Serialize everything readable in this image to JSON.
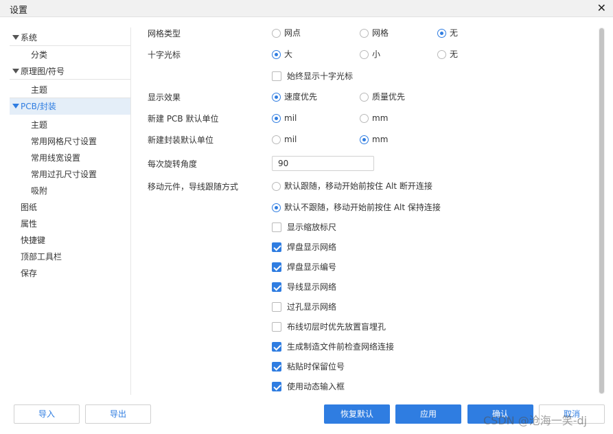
{
  "window": {
    "title": "设置",
    "close_glyph": "✕"
  },
  "sidebar": {
    "items": [
      {
        "label": "系统",
        "expanded": true
      },
      {
        "label": "分类"
      },
      {
        "label": "原理图/符号",
        "expanded": true
      },
      {
        "label": "主题"
      },
      {
        "label": "PCB/封装",
        "expanded": true,
        "selected": true
      },
      {
        "label": "主题"
      },
      {
        "label": "常用网格尺寸设置"
      },
      {
        "label": "常用线宽设置"
      },
      {
        "label": "常用过孔尺寸设置"
      },
      {
        "label": "吸附"
      },
      {
        "label": "图纸"
      },
      {
        "label": "属性"
      },
      {
        "label": "快捷键"
      },
      {
        "label": "顶部工具栏"
      },
      {
        "label": "保存"
      }
    ]
  },
  "settings": {
    "grid_type": {
      "label": "网格类型",
      "options": [
        "网点",
        "网格",
        "无"
      ],
      "selected": "无"
    },
    "crosshair": {
      "label": "十字光标",
      "options": [
        "大",
        "小",
        "无"
      ],
      "selected": "大",
      "always_show_label": "始终显示十字光标",
      "always_show": false
    },
    "display_effect": {
      "label": "显示效果",
      "options": [
        "速度优先",
        "质量优先"
      ],
      "selected": "速度优先"
    },
    "pcb_unit": {
      "label": "新建 PCB 默认单位",
      "options": [
        "mil",
        "mm"
      ],
      "selected": "mil"
    },
    "footprint_unit": {
      "label": "新建封装默认单位",
      "options": [
        "mil",
        "mm"
      ],
      "selected": "mm"
    },
    "rotation": {
      "label": "每次旋转角度",
      "value": "90"
    },
    "move_mode": {
      "label": "移动元件，导线跟随方式",
      "options": [
        "默认跟随，移动开始前按住 Alt 断开连接",
        "默认不跟随，移动开始前按住 Alt 保持连接"
      ],
      "selected": "默认不跟随，移动开始前按住 Alt 保持连接"
    },
    "checkboxes": [
      {
        "label": "显示缩放标尺",
        "checked": false
      },
      {
        "label": "焊盘显示网络",
        "checked": true
      },
      {
        "label": "焊盘显示编号",
        "checked": true
      },
      {
        "label": "导线显示网络",
        "checked": true
      },
      {
        "label": "过孔显示网络",
        "checked": false
      },
      {
        "label": "布线切层时优先放置盲埋孔",
        "checked": false
      },
      {
        "label": "生成制造文件前检查网络连接",
        "checked": true
      },
      {
        "label": "粘贴时保留位号",
        "checked": true
      },
      {
        "label": "使用动态输入框",
        "checked": true
      }
    ]
  },
  "footer": {
    "import_label": "导入",
    "export_label": "导出",
    "reset_label": "恢复默认",
    "apply_label": "应用",
    "ok_label": "确认",
    "cancel_label": "取消"
  },
  "watermark": "CSDN @沧海一笑-dj",
  "colors": {
    "accent": "#2f7de1",
    "selected_bg": "#e4eef8",
    "text": "#333333"
  }
}
